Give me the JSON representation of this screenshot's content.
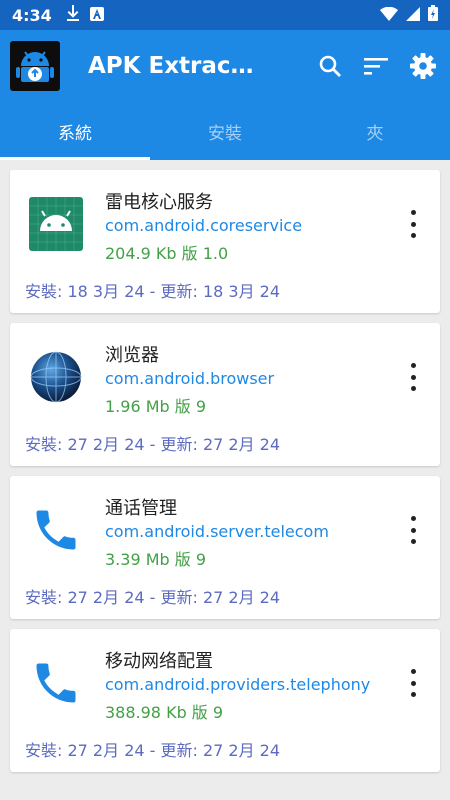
{
  "status_bar": {
    "time": "4:34"
  },
  "app_bar": {
    "title": "APK Extractor"
  },
  "tabs": [
    {
      "label": "系統"
    },
    {
      "label": "安裝"
    },
    {
      "label": "夾"
    }
  ],
  "apps": [
    {
      "name": "雷电核心服务",
      "package": "com.android.coreservice",
      "size": "204.9 Kb 版 1.0",
      "dates": "安裝: 18 3月 24 - 更新: 18 3月 24",
      "icon": "android-robot-icon"
    },
    {
      "name": "浏览器",
      "package": "com.android.browser",
      "size": "1.96 Mb 版 9",
      "dates": "安裝: 27 2月 24 - 更新: 27 2月 24",
      "icon": "globe-icon"
    },
    {
      "name": "通话管理",
      "package": "com.android.server.telecom",
      "size": "3.39 Mb 版 9",
      "dates": "安裝: 27 2月 24 - 更新: 27 2月 24",
      "icon": "phone-icon"
    },
    {
      "name": "移动网络配置",
      "package": "com.android.providers.telephony",
      "size": "388.98 Kb 版 9",
      "dates": "安裝: 27 2月 24 - 更新: 27 2月 24",
      "icon": "phone-icon"
    }
  ],
  "colors": {
    "status_bar": "#1565c0",
    "app_bar": "#1e88e5",
    "package_text": "#1e88e5",
    "size_text": "#43a047",
    "date_text": "#5c6bc0"
  }
}
